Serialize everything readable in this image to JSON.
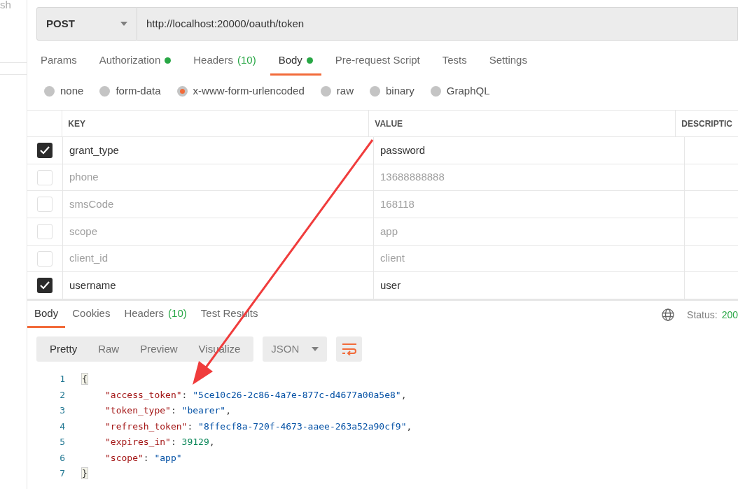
{
  "sidebar": {
    "partial_text": "sh"
  },
  "request": {
    "method": "POST",
    "url": "http://localhost:20000/oauth/token"
  },
  "request_tabs": [
    {
      "label": "Params",
      "selected": false
    },
    {
      "label": "Authorization",
      "selected": false,
      "dot": true
    },
    {
      "label": "Headers",
      "count": "(10)",
      "selected": false
    },
    {
      "label": "Body",
      "selected": true,
      "dot": true
    },
    {
      "label": "Pre-request Script",
      "selected": false
    },
    {
      "label": "Tests",
      "selected": false
    },
    {
      "label": "Settings",
      "selected": false
    }
  ],
  "body_types": [
    {
      "label": "none",
      "selected": false
    },
    {
      "label": "form-data",
      "selected": false
    },
    {
      "label": "x-www-form-urlencoded",
      "selected": true
    },
    {
      "label": "raw",
      "selected": false
    },
    {
      "label": "binary",
      "selected": false
    },
    {
      "label": "GraphQL",
      "selected": false
    }
  ],
  "table": {
    "columns": [
      "KEY",
      "VALUE",
      "DESCRIPTIC"
    ],
    "rows": [
      {
        "checked": true,
        "key": "grant_type",
        "value": "password"
      },
      {
        "checked": false,
        "key": "phone",
        "value": "13688888888"
      },
      {
        "checked": false,
        "key": "smsCode",
        "value": "168118"
      },
      {
        "checked": false,
        "key": "scope",
        "value": "app"
      },
      {
        "checked": false,
        "key": "client_id",
        "value": "client"
      },
      {
        "checked": true,
        "key": "username",
        "value": "user"
      }
    ]
  },
  "response_tabs": [
    {
      "label": "Body",
      "selected": true
    },
    {
      "label": "Cookies",
      "selected": false
    },
    {
      "label": "Headers",
      "count": "(10)",
      "selected": false
    },
    {
      "label": "Test Results",
      "selected": false
    }
  ],
  "status": {
    "label": "Status:",
    "value": "200"
  },
  "view_modes": [
    {
      "label": "Pretty",
      "selected": true
    },
    {
      "label": "Raw",
      "selected": false
    },
    {
      "label": "Preview",
      "selected": false
    },
    {
      "label": "Visualize",
      "selected": false
    }
  ],
  "format": "JSON",
  "code": [
    {
      "number": "1",
      "tokens": [
        {
          "kind": "brace",
          "text": "{"
        }
      ]
    },
    {
      "number": "2",
      "tokens": [
        {
          "kind": "key",
          "text": "\"access_token\""
        },
        {
          "kind": "punct",
          "text": ": "
        },
        {
          "kind": "string",
          "text": "\"5ce10c26-2c86-4a7e-877c-d4677a00a5e8\""
        },
        {
          "kind": "punct",
          "text": ","
        }
      ]
    },
    {
      "number": "3",
      "tokens": [
        {
          "kind": "key",
          "text": "\"token_type\""
        },
        {
          "kind": "punct",
          "text": ": "
        },
        {
          "kind": "string",
          "text": "\"bearer\""
        },
        {
          "kind": "punct",
          "text": ","
        }
      ]
    },
    {
      "number": "4",
      "tokens": [
        {
          "kind": "key",
          "text": "\"refresh_token\""
        },
        {
          "kind": "punct",
          "text": ": "
        },
        {
          "kind": "string",
          "text": "\"8ffecf8a-720f-4673-aaee-263a52a90cf9\""
        },
        {
          "kind": "punct",
          "text": ","
        }
      ]
    },
    {
      "number": "5",
      "tokens": [
        {
          "kind": "key",
          "text": "\"expires_in\""
        },
        {
          "kind": "punct",
          "text": ": "
        },
        {
          "kind": "number",
          "text": "39129"
        },
        {
          "kind": "punct",
          "text": ","
        }
      ]
    },
    {
      "number": "6",
      "tokens": [
        {
          "kind": "key",
          "text": "\"scope\""
        },
        {
          "kind": "punct",
          "text": ": "
        },
        {
          "kind": "string",
          "text": "\"app\""
        }
      ]
    },
    {
      "number": "7",
      "tokens": [
        {
          "kind": "brace",
          "text": "}"
        }
      ]
    }
  ]
}
